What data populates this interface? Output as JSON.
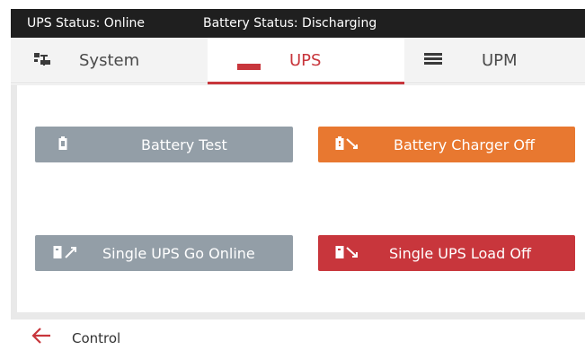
{
  "status": {
    "ups_status": "UPS Status: Online",
    "battery_status": "Battery Status: Discharging"
  },
  "tabs": [
    {
      "label": "System",
      "icon": "system-tree-icon",
      "active": false
    },
    {
      "label": "UPS",
      "icon": "ups-icon",
      "active": true
    },
    {
      "label": "UPM",
      "icon": "upm-list-icon",
      "active": false
    }
  ],
  "buttons": [
    {
      "label": "Battery Test",
      "icon": "battery-icon",
      "color": "#939ea7"
    },
    {
      "label": "Battery Charger Off",
      "icon": "battery-charger-off-icon",
      "color": "#e87830"
    },
    {
      "label": "Single UPS Go Online",
      "icon": "ups-go-online-icon",
      "color": "#939ea7"
    },
    {
      "label": "Single UPS Load Off",
      "icon": "ups-load-off-icon",
      "color": "#c8363c"
    }
  ],
  "footer": {
    "back_icon": "back-arrow-icon",
    "label": "Control"
  },
  "colors": {
    "accent": "#c8363c",
    "status_bar": "#1f1f1f",
    "button_grey": "#939ea7",
    "button_orange": "#e87830",
    "button_red": "#c8363c"
  }
}
